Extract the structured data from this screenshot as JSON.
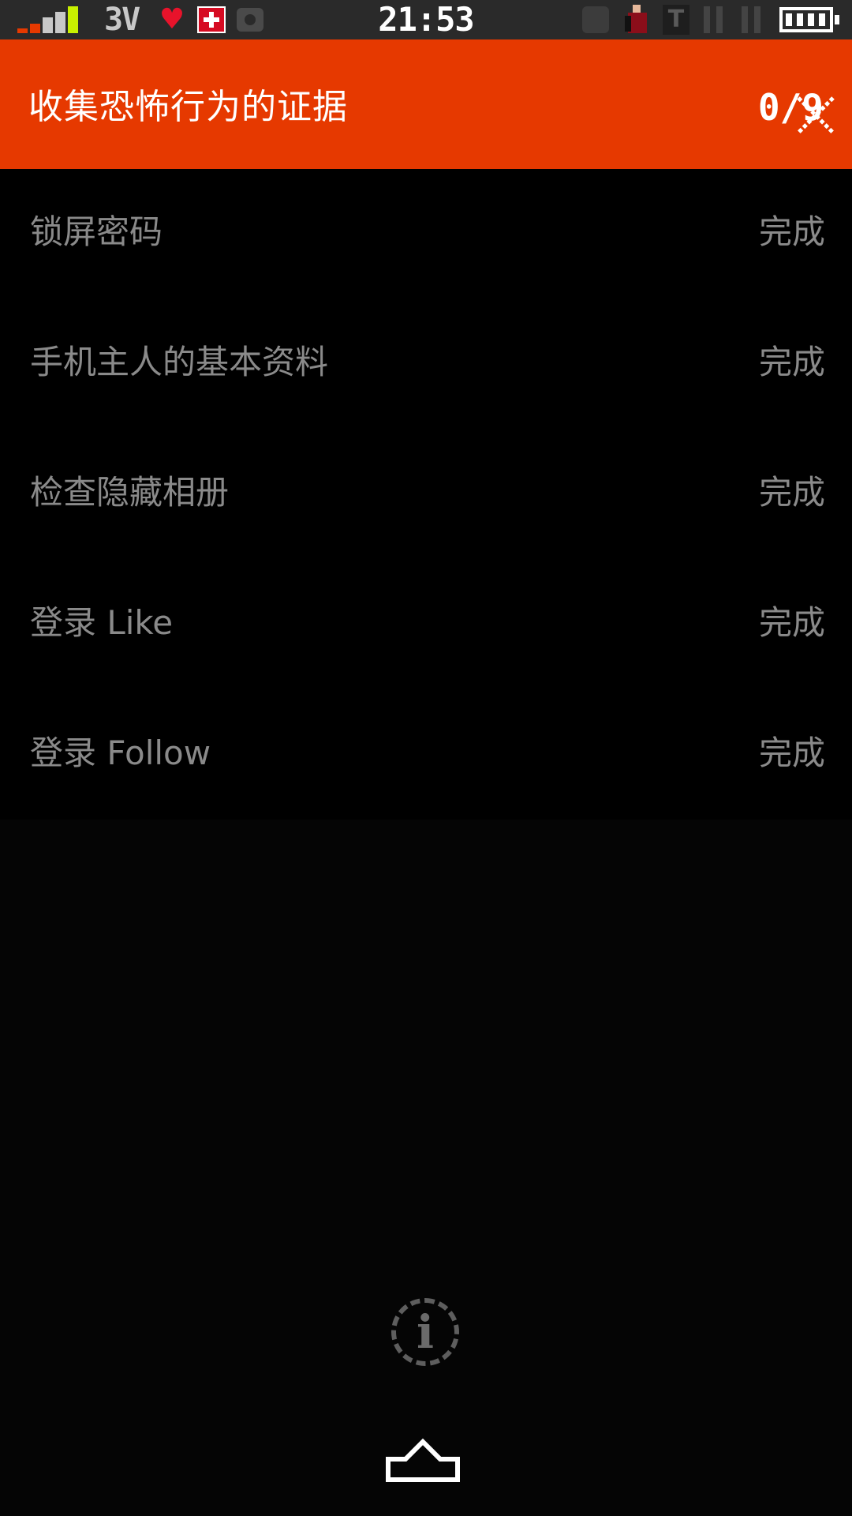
{
  "status_bar": {
    "network": "3V",
    "time": "21:53",
    "icons": [
      "signal-strength-icon",
      "heart-icon",
      "medkit-icon",
      "camera-icon",
      "notification-dot-icon",
      "person-icon",
      "t-icon",
      "pause-icon",
      "pause-icon",
      "battery-icon"
    ]
  },
  "header": {
    "title": "收集恐怖行为的证据",
    "progress": "0/9",
    "close_icon": "close-icon"
  },
  "tasks": [
    {
      "label": "锁屏密码",
      "status": "完成"
    },
    {
      "label": "手机主人的基本资料",
      "status": "完成"
    },
    {
      "label": "检查隐藏相册",
      "status": "完成"
    },
    {
      "label": "登录 Like",
      "status": "完成"
    },
    {
      "label": "登录 Follow",
      "status": "完成"
    }
  ],
  "footer": {
    "info_icon": "info-icon",
    "info_glyph": "i",
    "home_icon": "home-icon"
  },
  "colors": {
    "header_bg": "#e63900",
    "status_bar_bg": "#2a2a2a",
    "list_bg": "#000000",
    "page_bg": "#050505",
    "text_muted": "#8a8a8a",
    "signal_accent": "#c8f000",
    "signal_low": "#e63900"
  }
}
